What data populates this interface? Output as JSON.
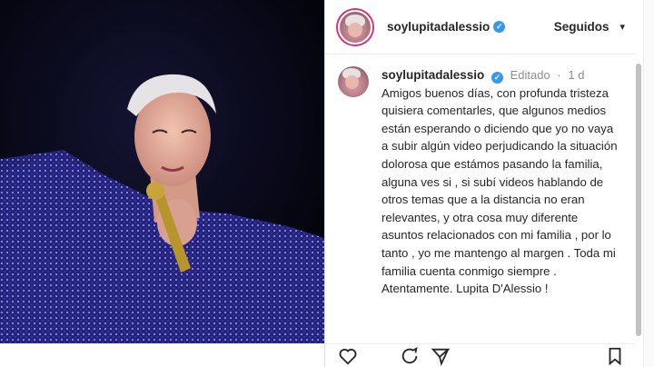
{
  "post": {
    "username": "soylupitadalessio",
    "follow_status": "Seguidos",
    "verified_mark": "✓"
  },
  "caption": {
    "username": "soylupitadalessio",
    "edited_label": "Editado",
    "separator": "·",
    "age": "1 d",
    "text": "Amigos buenos días, con profunda tristeza quisiera comentarles, que algunos medios están esperando o diciendo que yo no vaya a subir algún video perjudicando la situación dolorosa que estámos pasando la familia, alguna ves si , si subí videos hablando de otros temas que a la distancia no eran relevantes, y otra cosa muy  diferente asuntos relacionados con mi familia , por lo tanto , yo me mantengo al margen . Toda mi familia cuenta conmigo siempre . Atentamente. Lupita D'Alessio !"
  },
  "icons": {
    "like": "heart-icon",
    "comment": "comment-icon",
    "share": "share-icon",
    "save": "bookmark-icon"
  },
  "colors": {
    "verified": "#3897f0",
    "text": "#262626",
    "muted": "#8e8e8e",
    "photo_bg": "#04040c",
    "sequin": "#2c2b8c"
  }
}
